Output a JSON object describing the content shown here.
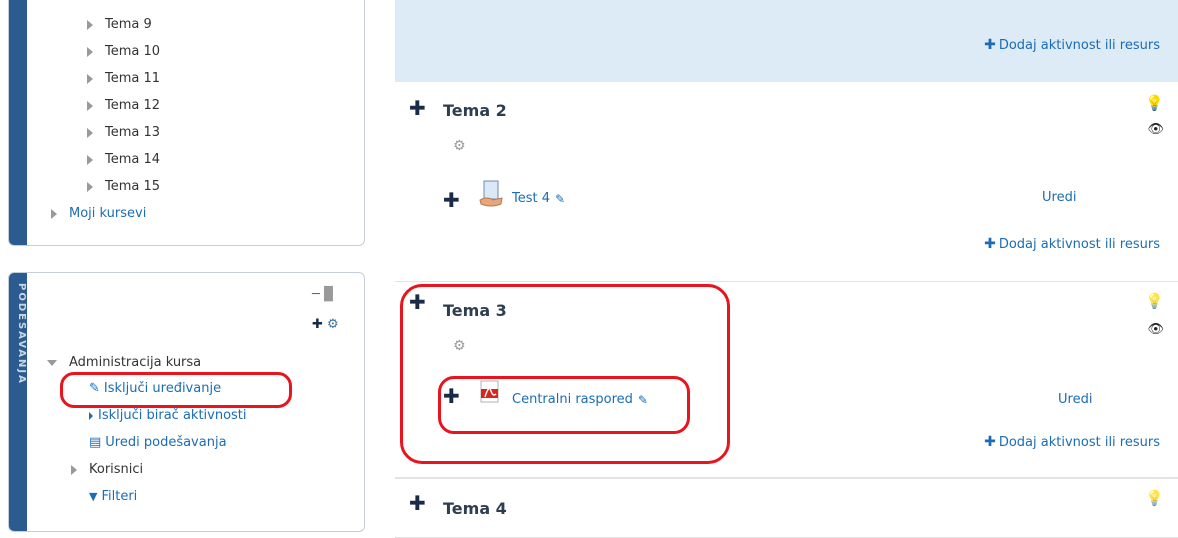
{
  "nav": {
    "items": [
      "Tema 9",
      "Tema 10",
      "Tema 11",
      "Tema 12",
      "Tema 13",
      "Tema 14",
      "Tema 15"
    ],
    "my_courses": "Moji kursevi"
  },
  "admin": {
    "side_label": "PODEŠAVANJA",
    "heading": "Administracija kursa",
    "turn_off_editing": "Isključi uređivanje",
    "turn_off_activity_chooser": "Isključi birač aktivnosti",
    "edit_settings": "Uredi podešavanja",
    "users": "Korisnici",
    "filters": "Filteri"
  },
  "main": {
    "add_activity": "Dodaj aktivnost ili resurs",
    "edit_label": "Uredi",
    "sections": [
      {
        "title": "Tema 2",
        "activity": "Test 4"
      },
      {
        "title": "Tema 3",
        "activity": "Centralni raspored"
      },
      {
        "title": "Tema 4"
      }
    ]
  },
  "colors": {
    "accent": "#1b6cb5",
    "sidebar_stripe": "#2b5b8f",
    "highlight_section": "#dcebf5",
    "annotation_red": "#e8141e"
  }
}
